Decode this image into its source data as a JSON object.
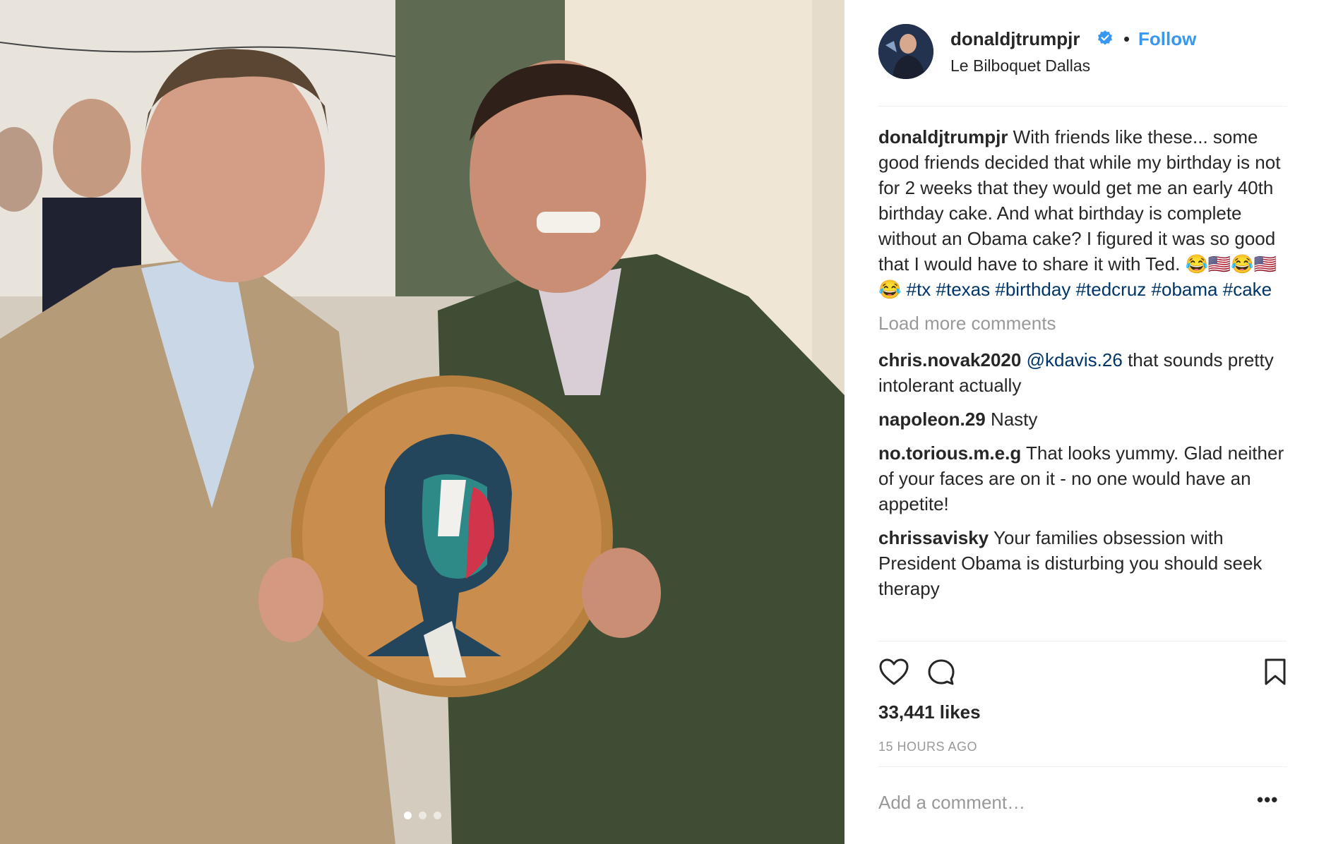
{
  "post": {
    "dots": 3,
    "active_dot": 0
  },
  "header": {
    "username": "donaldjtrumpjr",
    "separator": "•",
    "follow_label": "Follow",
    "location": "Le Bilboquet Dallas"
  },
  "caption": {
    "username": "donaldjtrumpjr",
    "text": "With friends like these... some good friends decided that while my birthday is not for 2 weeks that they would get me an early 40th birthday cake. And what birthday is complete without an Obama cake? I figured it was so good that I would have to share it with Ted. 😂🇺🇸😂🇺🇸😂",
    "hashtags": [
      "#tx",
      "#texas",
      "#birthday",
      "#tedcruz",
      "#obama",
      "#cake"
    ]
  },
  "load_more": "Load more comments",
  "comments": [
    {
      "username": "chris.novak2020",
      "mention": "@kdavis.26",
      "text": "that sounds pretty intolerant actually"
    },
    {
      "username": "napoleon.29",
      "mention": "",
      "text": "Nasty"
    },
    {
      "username": "no.torious.m.e.g",
      "mention": "",
      "text": "That looks yummy. Glad neither of your faces are on it - no one would have an appetite!"
    },
    {
      "username": "chrissavisky",
      "mention": "",
      "text": "Your families obsession with President Obama is disturbing you should seek therapy"
    }
  ],
  "actions": {
    "like_icon": "heart-icon",
    "comment_icon": "comment-icon",
    "save_icon": "bookmark-icon"
  },
  "likes": "33,441 likes",
  "timestamp": "15 HOURS AGO",
  "add_comment_placeholder": "Add a comment…",
  "more_label": "•••",
  "colors": {
    "accent": "#3897f0",
    "link": "#003569",
    "muted": "#999999",
    "divider": "#efefef"
  }
}
